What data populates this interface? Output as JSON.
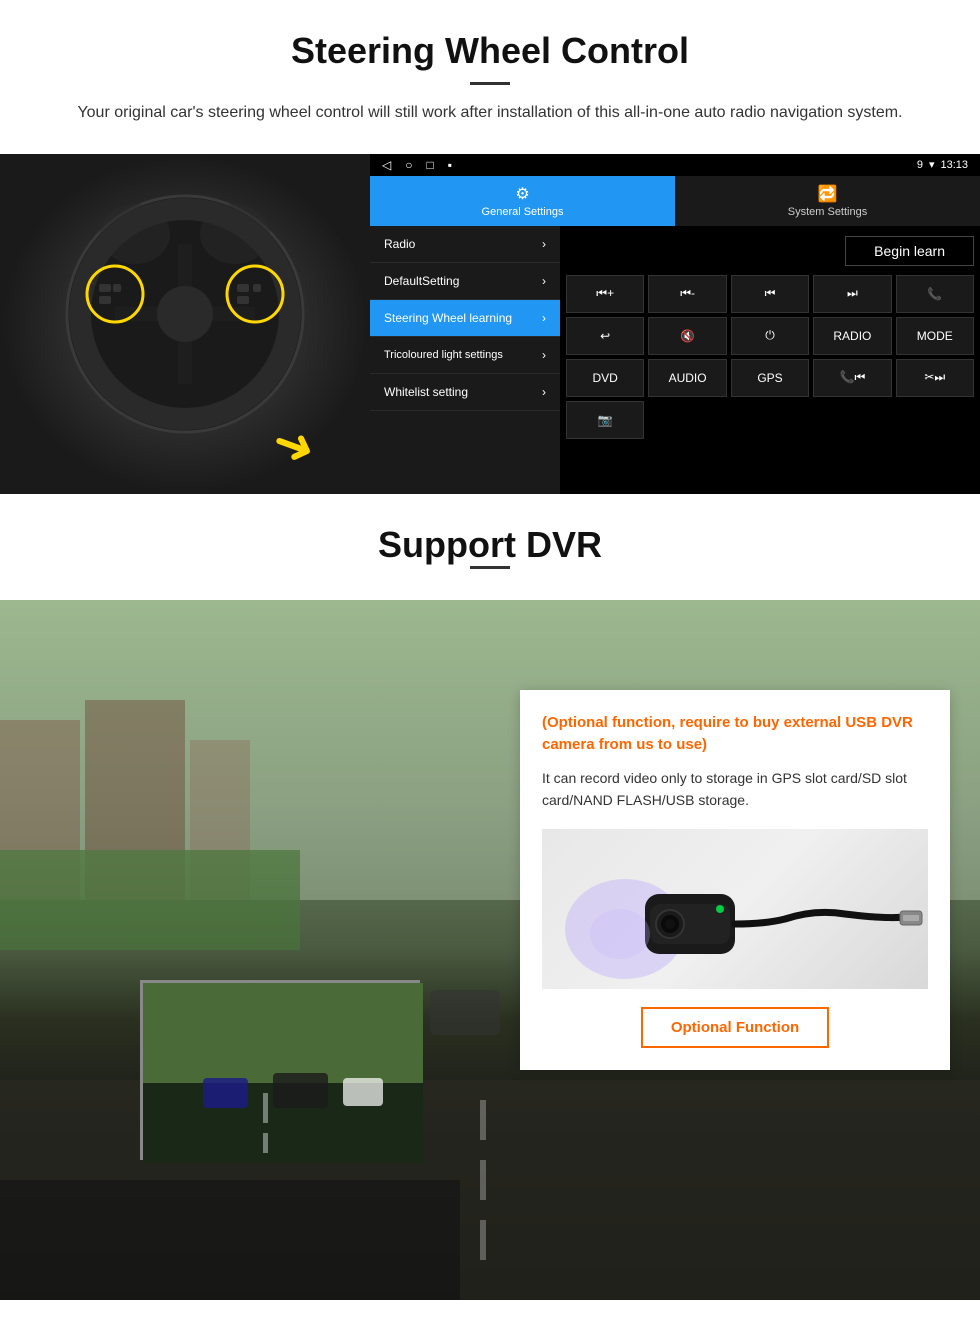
{
  "steering_section": {
    "title": "Steering Wheel Control",
    "description": "Your original car's steering wheel control will still work after installation of this all-in-one auto radio navigation system.",
    "status_bar": {
      "time": "13:13",
      "icons": "9 ▾"
    },
    "tabs": {
      "general": {
        "icon": "⚙",
        "label": "General Settings"
      },
      "system": {
        "icon": "🔁",
        "label": "System Settings"
      }
    },
    "menu_items": [
      {
        "label": "Radio",
        "active": false
      },
      {
        "label": "DefaultSetting",
        "active": false
      },
      {
        "label": "Steering Wheel learning",
        "active": true
      },
      {
        "label": "Tricoloured light settings",
        "active": false
      },
      {
        "label": "Whitelist setting",
        "active": false
      }
    ],
    "begin_learn_label": "Begin learn",
    "control_buttons": [
      "⏮+",
      "⏮-",
      "⏮|",
      "⏭|",
      "📞",
      "↩",
      "🔇x",
      "⏻",
      "RADIO",
      "MODE",
      "DVD",
      "AUDIO",
      "GPS",
      "📞⏮|",
      "✂⏭|",
      "📷"
    ]
  },
  "dvr_section": {
    "title": "Support DVR",
    "optional_text": "(Optional function, require to buy external USB DVR camera from us to use)",
    "description": "It can record video only to storage in GPS slot card/SD slot card/NAND FLASH/USB storage.",
    "optional_function_label": "Optional Function"
  }
}
